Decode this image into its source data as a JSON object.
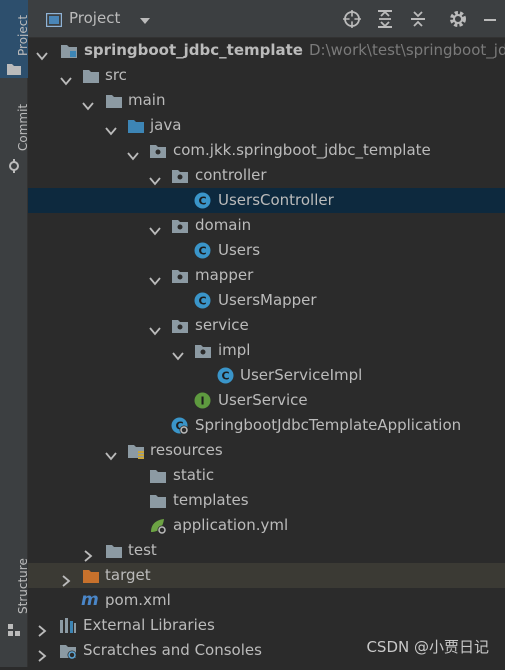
{
  "left_strip": {
    "tabs": [
      {
        "label": "Project",
        "icon": "folder-icon",
        "active": true
      },
      {
        "label": "Commit",
        "icon": "commit-icon",
        "active": false
      },
      {
        "label": "Structure",
        "icon": "structure-icon",
        "active": false
      }
    ]
  },
  "header": {
    "title": "Project",
    "icons": [
      "crosshair-icon",
      "expand-all-icon",
      "collapse-all-icon",
      "gear-icon",
      "minimize-icon"
    ]
  },
  "tree": {
    "root": {
      "label": "springboot_jdbc_template",
      "path": "D:\\work\\test\\springboot_jdbc"
    },
    "src": "src",
    "main": "main",
    "java": "java",
    "package": "com.jkk.springboot_jdbc_template",
    "controller": "controller",
    "users_controller": "UsersController",
    "domain": "domain",
    "users": "Users",
    "mapper": "mapper",
    "users_mapper": "UsersMapper",
    "service": "service",
    "impl": "impl",
    "user_service_impl": "UserServiceImpl",
    "user_service": "UserService",
    "application_class": "SpringbootJdbcTemplateApplication",
    "resources": "resources",
    "static": "static",
    "templates": "templates",
    "application_yml": "application.yml",
    "test": "test",
    "target": "target",
    "pom": "pom.xml",
    "external_libraries": "External Libraries",
    "scratches": "Scratches and Consoles"
  },
  "watermark": "CSDN @小贾日记",
  "colors": {
    "selection": "#0d293e",
    "class_icon": "#3a95c9",
    "interface_icon": "#5e9a3f",
    "folder": "#8c9aa3",
    "source_folder": "#3d85b5",
    "target_folder": "#c7712c"
  }
}
